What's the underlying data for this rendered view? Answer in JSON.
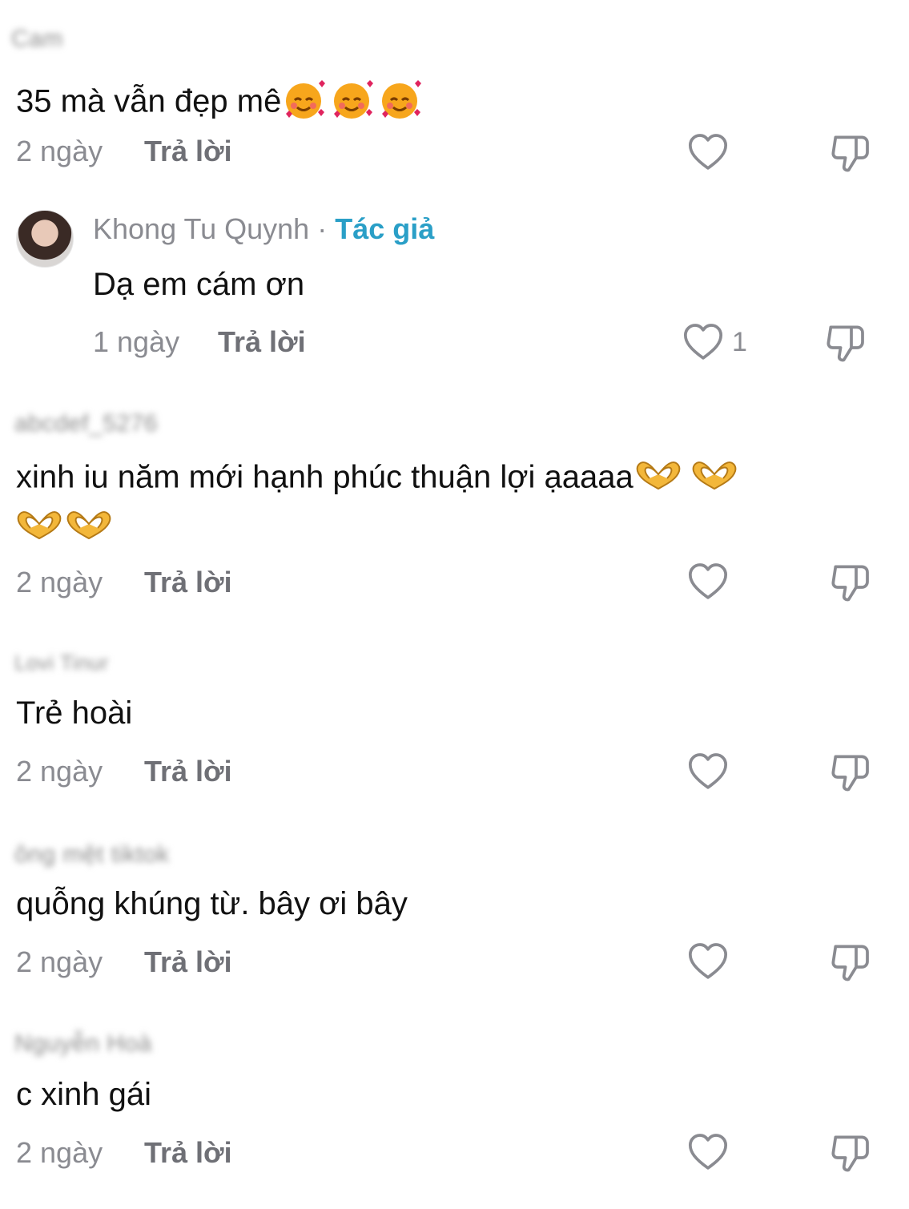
{
  "comments": [
    {
      "username": "Cam",
      "text": "35 mà vẫn đẹp mê",
      "emojis": [
        "smiling-face-with-hearts-emoji",
        "smiling-face-with-hearts-emoji",
        "smiling-face-with-hearts-emoji"
      ],
      "date": "2 ngày",
      "reply_label": "Trả lời"
    },
    {
      "reply": true,
      "username": "Khong Tu Quynh",
      "separator": " · ",
      "author_tag": "Tác giả",
      "text": "Dạ em cám ơn",
      "date": "1 ngày",
      "reply_label": "Trả lời",
      "like_count": "1"
    },
    {
      "username": "abcdef_5276",
      "text": "xinh iu năm mới hạnh phúc thuận lợi ạaaaa",
      "emojis": [
        "heart-hands-emoji",
        "heart-hands-emoji",
        "heart-hands-emoji",
        "heart-hands-emoji"
      ],
      "date": "2 ngày",
      "reply_label": "Trả lời"
    },
    {
      "username": "Lovi Tinur",
      "text": "Trẻ hoài",
      "date": "2 ngày",
      "reply_label": "Trả lời"
    },
    {
      "username": "ông mệt tiktok",
      "text": "quỗng khúng từ. bây ơi bây",
      "date": "2 ngày",
      "reply_label": "Trả lời"
    },
    {
      "username": "Nguyễn Hoà",
      "text": "c xinh gái",
      "date": "2 ngày",
      "reply_label": "Trả lời"
    }
  ],
  "colors": {
    "text": "#111111",
    "meta": "#8a8b91",
    "author_tag": "#2a9fc7",
    "icon": "#8a8b91",
    "background": "#ffffff"
  }
}
